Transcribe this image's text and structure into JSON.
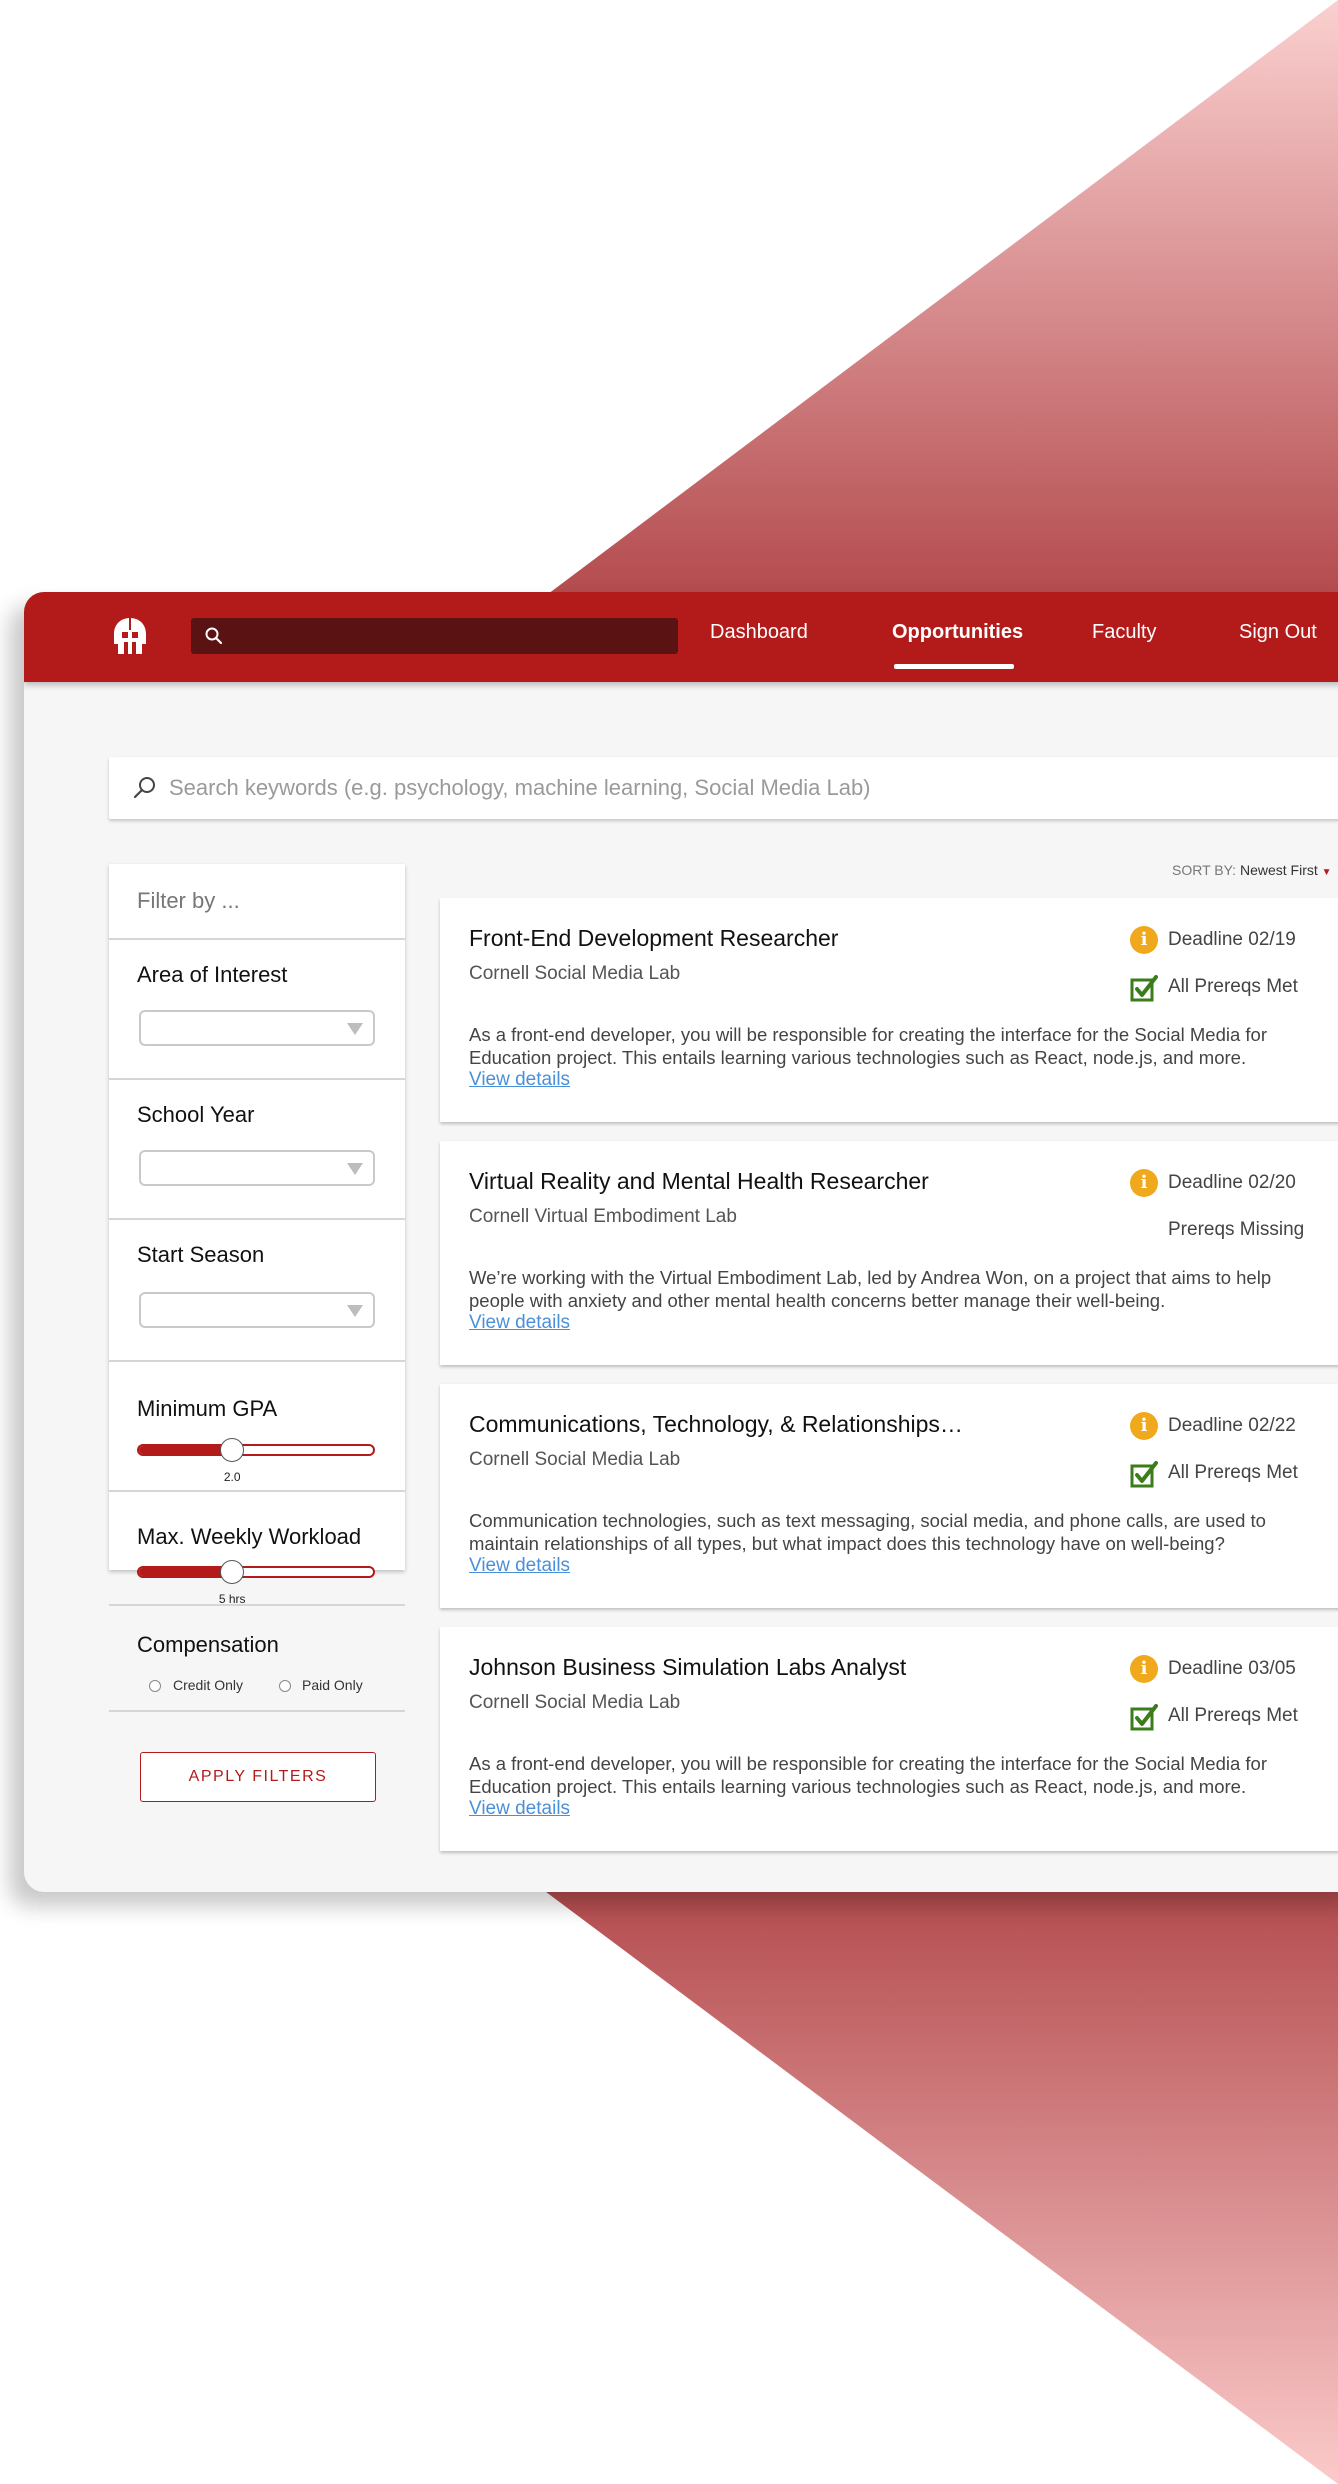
{
  "nav": {
    "links": [
      "Dashboard",
      "Opportunities",
      "Faculty",
      "Sign Out"
    ],
    "active": "Opportunities"
  },
  "search": {
    "placeholder": "Search keywords (e.g. psychology, machine learning, Social Media Lab)"
  },
  "filters": {
    "header": "Filter by ...",
    "area_label": "Area of Interest",
    "year_label": "School Year",
    "season_label": "Start Season",
    "gpa_label": "Minimum GPA",
    "gpa_value": "2.0",
    "gpa_level": 0.4,
    "workload_label": "Max. Weekly Workload",
    "workload_value": "5 hrs",
    "workload_level": 0.4,
    "compensation_label": "Compensation",
    "credit_label": "Credit Only",
    "paid_label": "Paid Only",
    "apply_label": "APPLY FILTERS"
  },
  "sort": {
    "label": "SORT BY:",
    "value": "Newest First"
  },
  "cards": [
    {
      "title": "Front-End Development Researcher",
      "lab": "Cornell Social Media Lab",
      "deadline": "Deadline 02/19",
      "prereq": "All Prereqs Met",
      "prereq_met": true,
      "desc": "As a front-end developer, you will be responsible for creating the interface for the Social Media for Education project. This entails learning various technologies such as React, node.js, and more.",
      "link": "View details"
    },
    {
      "title": "Virtual Reality and Mental Health Researcher",
      "lab": "Cornell Virtual Embodiment Lab",
      "deadline": "Deadline 02/20",
      "prereq": "Prereqs Missing",
      "prereq_met": false,
      "desc": "We’re working with the Virtual Embodiment Lab, led by Andrea Won, on a project that aims to help people with anxiety and other mental health concerns better manage their well-being.",
      "link": "View details"
    },
    {
      "title": "Communications, Technology, & Relationships…",
      "lab": "Cornell Social Media Lab",
      "deadline": "Deadline 02/22",
      "prereq": "All Prereqs Met",
      "prereq_met": true,
      "desc": "Communication technologies, such as text messaging, social media, and phone calls, are used to maintain relationships of all types, but what impact does this technology have on well-being?",
      "link": "View details"
    },
    {
      "title": "Johnson Business Simulation Labs Analyst",
      "lab": "Cornell Social Media Lab",
      "deadline": "Deadline 03/05",
      "prereq": "All Prereqs Met",
      "prereq_met": true,
      "desc": "As a front-end developer, you will be responsible for creating the interface for the Social Media for Education project. This entails learning various technologies such as React, node.js, and more.",
      "link": "View details"
    }
  ],
  "icons": {
    "logo": "spartan-helmet-icon",
    "deadline": "info-icon",
    "prereq": "checkbox-checked-icon",
    "search": "search-icon"
  },
  "colors": {
    "brand": "#b31b1b",
    "nav_search": "#5a1212",
    "deadline": "#f0a81c",
    "prereq_met": "#3a7d1a",
    "link": "#4a90d9"
  }
}
